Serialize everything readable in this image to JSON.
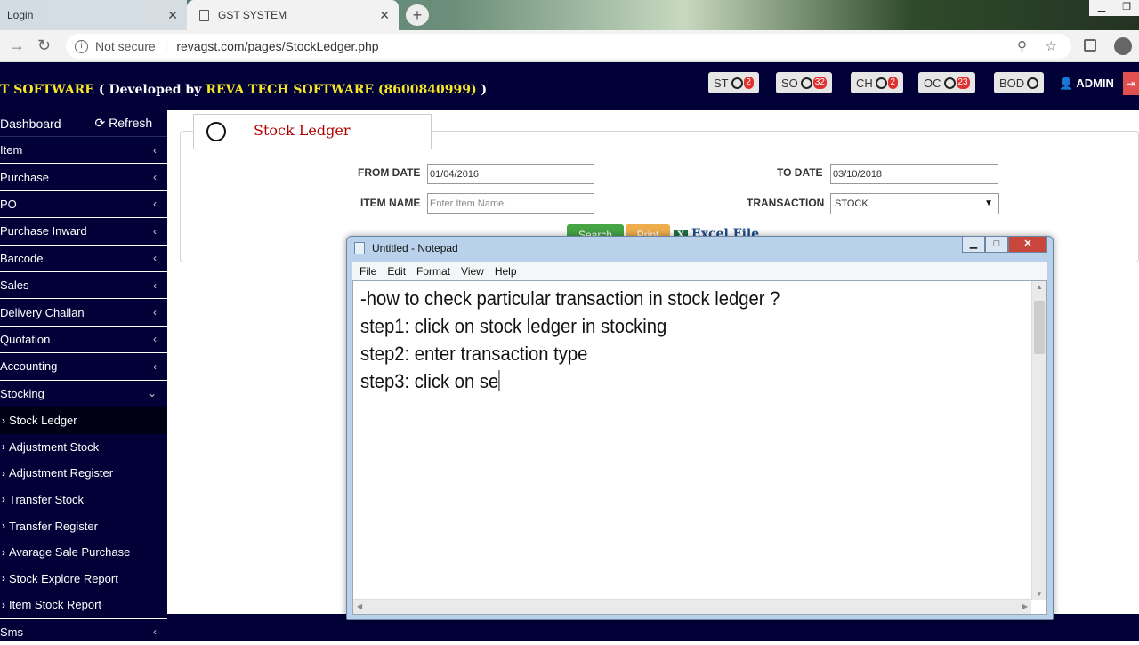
{
  "browser": {
    "tabs": [
      {
        "label": "Login"
      },
      {
        "label": "GST SYSTEM"
      }
    ],
    "security_label": "Not secure",
    "url": "revagst.com/pages/StockLedger.php"
  },
  "header": {
    "title_prefix": "T SOFTWARE",
    "title_developed": " ( Developed by ",
    "title_company": "REVA TECH SOFTWARE (8600840999)",
    "title_close": " )",
    "buttons": [
      {
        "label": "ST",
        "badge": "2"
      },
      {
        "label": "SO",
        "badge": "32"
      },
      {
        "label": "CH",
        "badge": "2"
      },
      {
        "label": "OC",
        "badge": "23"
      },
      {
        "label": "BOD",
        "badge": ""
      }
    ],
    "admin_label": "ADMIN"
  },
  "sidebar": {
    "dashboard": "Dashboard",
    "refresh": "Refresh",
    "items": [
      {
        "label": "Item"
      },
      {
        "label": "Purchase"
      },
      {
        "label": "PO"
      },
      {
        "label": "Purchase Inward"
      },
      {
        "label": "Barcode"
      },
      {
        "label": "Sales"
      },
      {
        "label": "Delivery Challan"
      },
      {
        "label": "Quotation"
      },
      {
        "label": "Accounting"
      },
      {
        "label": "Stocking"
      }
    ],
    "sub_items": [
      {
        "label": "Stock Ledger"
      },
      {
        "label": "Adjustment Stock"
      },
      {
        "label": "Adjustment Register"
      },
      {
        "label": "Transfer Stock"
      },
      {
        "label": "Transfer Register"
      },
      {
        "label": "Avarage Sale Purchase"
      },
      {
        "label": "Stock Explore Report"
      },
      {
        "label": "Item Stock Report"
      }
    ],
    "bottom_item": "Sms"
  },
  "main": {
    "panel_title": "Stock Ledger",
    "from_date_label": "FROM DATE",
    "from_date_value": "01/04/2016",
    "to_date_label": "TO DATE",
    "to_date_value": "03/10/2018",
    "item_name_label": "ITEM NAME",
    "item_name_placeholder": "Enter Item Name..",
    "transaction_label": "TRANSACTION",
    "transaction_value": "STOCK",
    "search_label": "Search",
    "print_label": "Print",
    "excel_label": "Excel File"
  },
  "notepad": {
    "title": "Untitled - Notepad",
    "menu": [
      "File",
      "Edit",
      "Format",
      "View",
      "Help"
    ],
    "lines": [
      "-how to check particular transaction in stock ledger ?",
      "step1: click on stock ledger in stocking",
      "step2: enter transaction type",
      "step3: click on se"
    ]
  }
}
